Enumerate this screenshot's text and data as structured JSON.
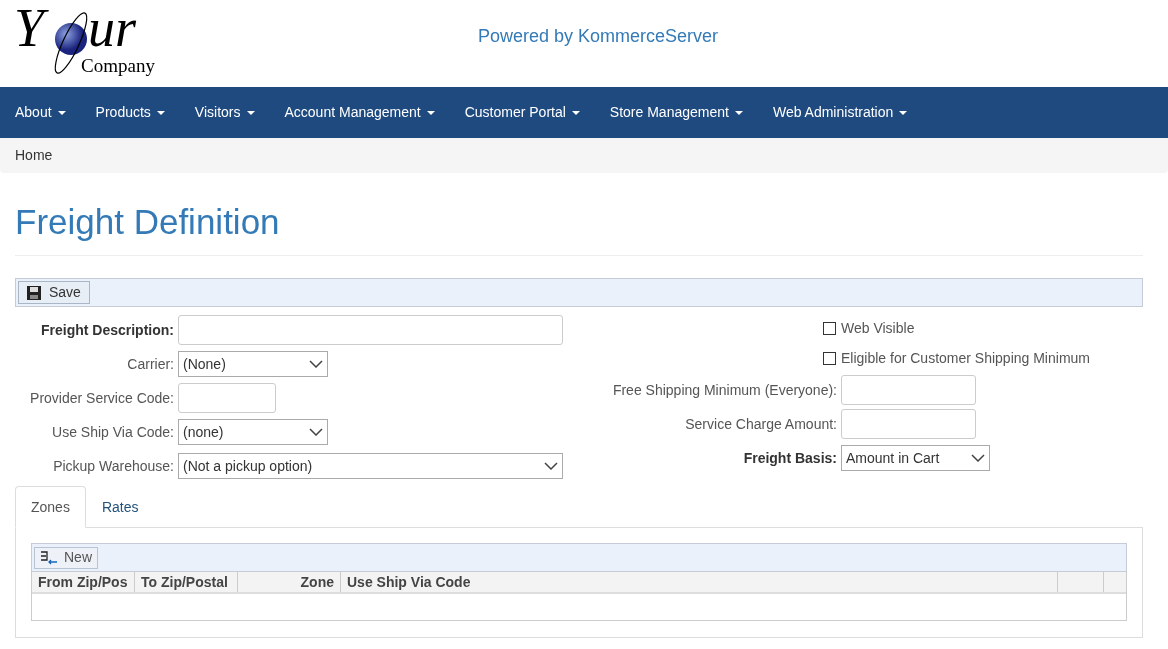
{
  "header": {
    "logo": {
      "big_letter": "Y",
      "big_rest": "ur",
      "small": "Company"
    },
    "tagline": "Powered by KommerceServer"
  },
  "nav": [
    {
      "label": "About"
    },
    {
      "label": "Products"
    },
    {
      "label": "Visitors"
    },
    {
      "label": "Account Management"
    },
    {
      "label": "Customer Portal"
    },
    {
      "label": "Store Management"
    },
    {
      "label": "Web Administration"
    }
  ],
  "breadcrumb": [
    "Home"
  ],
  "page_title": "Freight Definition",
  "toolbar": {
    "save": "Save"
  },
  "left_fields": [
    {
      "kind": "text",
      "label": "Freight Description:",
      "bold": true
    },
    {
      "kind": "select",
      "label": "Carrier:",
      "bold": false,
      "value": "(None)"
    },
    {
      "kind": "text",
      "label": "Provider Service Code:",
      "bold": false
    },
    {
      "kind": "select",
      "label": "Use Ship Via Code:",
      "bold": false,
      "value": "(none)"
    },
    {
      "kind": "select",
      "label": "Pickup Warehouse:",
      "bold": false,
      "value": "(Not a pickup option)"
    }
  ],
  "right_fields": [
    {
      "kind": "checkbox",
      "label": "Web Visible",
      "checked": false
    },
    {
      "kind": "checkbox",
      "label": "Eligible for Customer Shipping Minimum",
      "checked": false
    },
    {
      "kind": "text",
      "label": "Free Shipping Minimum (Everyone):",
      "bold": false
    },
    {
      "kind": "text",
      "label": "Service Charge Amount:",
      "bold": false
    },
    {
      "kind": "select",
      "label": "Freight Basis:",
      "bold": true,
      "value": "Amount in Cart"
    }
  ],
  "tabs": [
    {
      "label": "Zones",
      "selected": true
    },
    {
      "label": "Rates",
      "selected": false
    }
  ],
  "zones_grid": {
    "new_button": "New",
    "columns": [
      {
        "label": "From Zip/Pos"
      },
      {
        "label": "To Zip/Postal"
      },
      {
        "label": "Zone"
      },
      {
        "label": "Use Ship Via Code"
      }
    ]
  }
}
